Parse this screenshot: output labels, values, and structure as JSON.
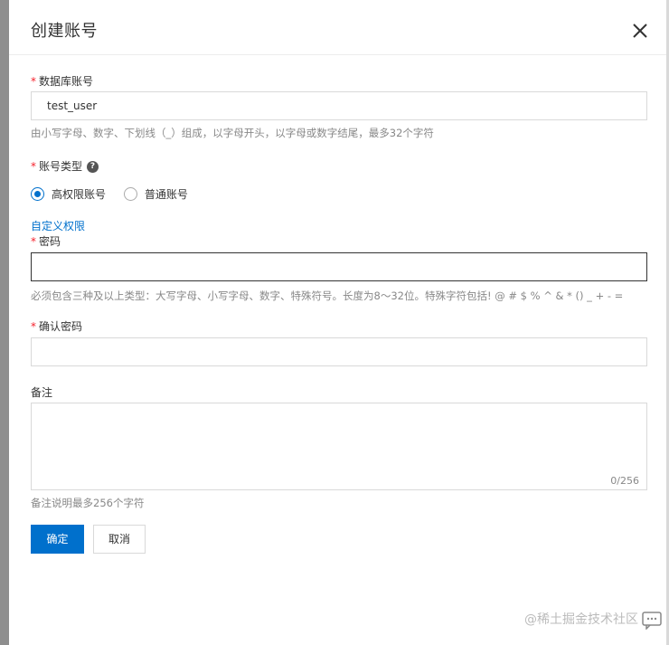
{
  "dialog": {
    "title": "创建账号"
  },
  "form": {
    "required_mark": "*",
    "db_account": {
      "label": "数据库账号",
      "value": "test_user",
      "hint": "由小写字母、数字、下划线（_）组成，以字母开头，以字母或数字结尾，最多32个字符"
    },
    "account_type": {
      "label": "账号类型",
      "help_glyph": "?",
      "options": [
        "高权限账号",
        "普通账号"
      ],
      "selected": "高权限账号"
    },
    "custom_permission_link": "自定义权限",
    "password": {
      "label": "密码",
      "value": "",
      "hint": "必须包含三种及以上类型：大写字母、小写字母、数字、特殊符号。长度为8～32位。特殊字符包括! @ # $ % ^ & * () _ + - ="
    },
    "confirm_password": {
      "label": "确认密码",
      "value": ""
    },
    "remark": {
      "label": "备注",
      "value": "",
      "counter": "0/256",
      "hint": "备注说明最多256个字符"
    }
  },
  "buttons": {
    "confirm": "确定",
    "cancel": "取消"
  },
  "watermark": "@稀土掘金技术社区",
  "colors": {
    "primary": "#0070cc",
    "required": "#f5222d",
    "hint": "#888888",
    "side_bar": "#8e8e8e"
  },
  "icons": [
    "close-icon",
    "help-icon",
    "chat-icon"
  ]
}
